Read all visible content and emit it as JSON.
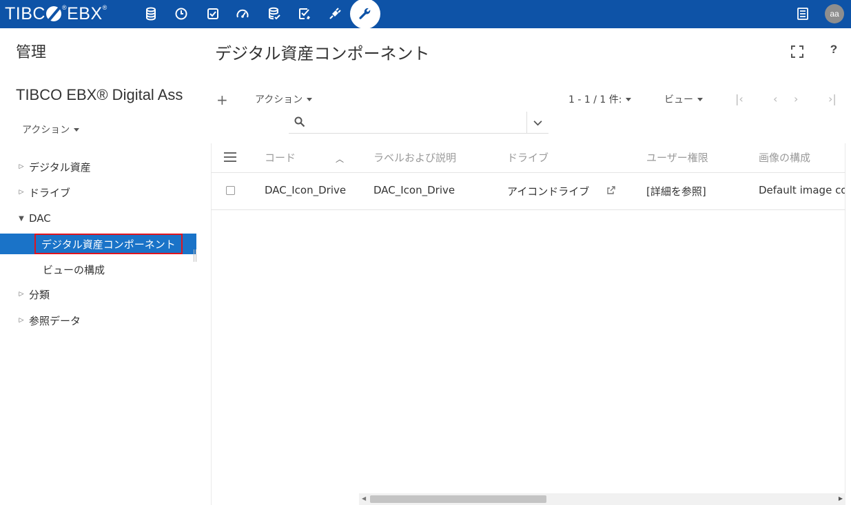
{
  "app": {
    "logo_text": "TIBC",
    "logo_text2": "EBX",
    "logo_reg": "®",
    "avatar_initials": "aa",
    "brand_color": "#0e53a7",
    "selection_color": "#1a73c8",
    "highlight_border_color": "#e1141d"
  },
  "topnav": {
    "icons": [
      "database-icon",
      "clock-icon",
      "checkbox-icon",
      "speedometer-icon",
      "dataspace-icon",
      "task-check-icon",
      "plug-icon",
      "wrench-icon"
    ],
    "active": "wrench-icon"
  },
  "left": {
    "title": "管理",
    "subtitle": "TIBCO EBX® Digital Ass",
    "action_label": "アクション",
    "tree": [
      {
        "label": "デジタル資産",
        "state": "collapsed"
      },
      {
        "label": "ドライブ",
        "state": "collapsed"
      },
      {
        "label": "DAC",
        "state": "expanded"
      },
      {
        "label": "デジタル資産コンポーネント",
        "state": "selected"
      },
      {
        "label": "ビューの構成",
        "state": "child"
      },
      {
        "label": "分類",
        "state": "collapsed"
      },
      {
        "label": "参照データ",
        "state": "collapsed"
      }
    ]
  },
  "main": {
    "title": "デジタル資産コンポーネント",
    "toolbar": {
      "plus": "+",
      "action_label": "アクション",
      "count": "1 - 1 / 1 件:",
      "view_label": "ビュー",
      "pager_first": "|‹",
      "pager_prev": "‹",
      "pager_next": "›",
      "pager_last": "›|"
    },
    "search": {
      "placeholder": ""
    },
    "table": {
      "headers": [
        "コード",
        "ラベルおよび説明",
        "ドライブ",
        "ユーザー権限",
        "画像の構成"
      ],
      "rows": [
        {
          "code": "DAC_Icon_Drive",
          "label": "DAC_Icon_Drive",
          "drive": "アイコンドライブ",
          "permissions": "[詳細を参照]",
          "image_config": "Default image configuration"
        }
      ]
    }
  }
}
